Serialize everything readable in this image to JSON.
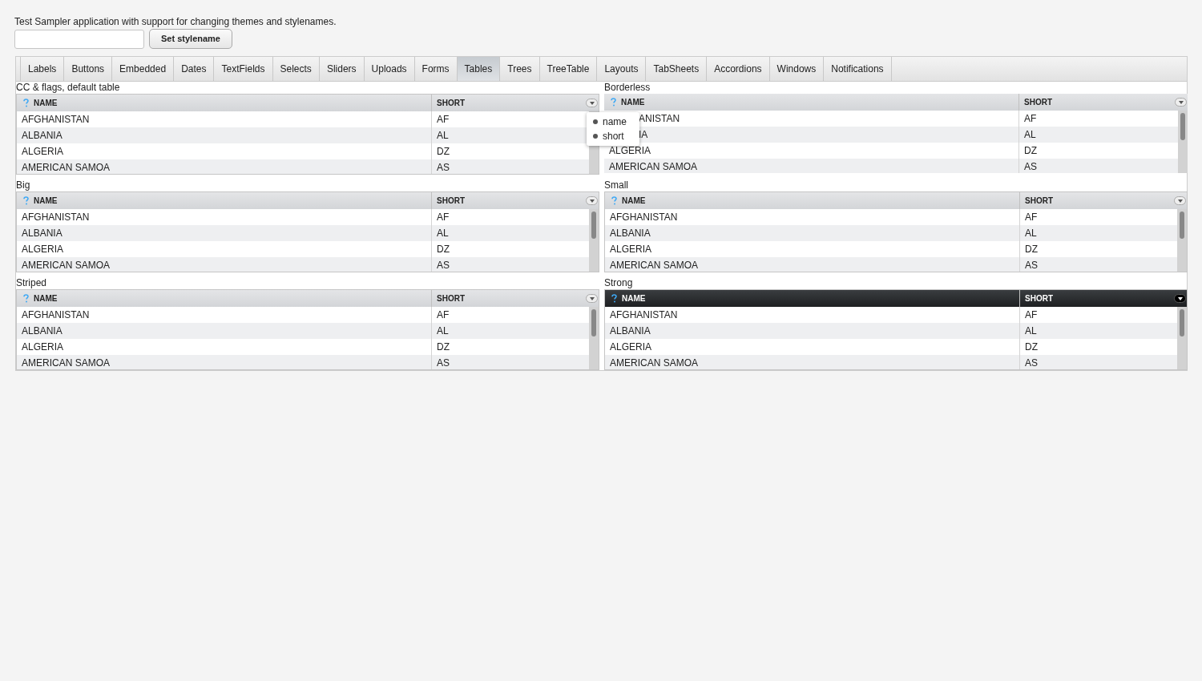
{
  "intro": "Test Sampler application with support for changing themes and stylenames.",
  "set_button": "Set stylename",
  "tabs": [
    {
      "label": "Labels",
      "selected": false
    },
    {
      "label": "Buttons",
      "selected": false
    },
    {
      "label": "Embedded",
      "selected": false
    },
    {
      "label": "Dates",
      "selected": false
    },
    {
      "label": "TextFields",
      "selected": false
    },
    {
      "label": "Selects",
      "selected": false
    },
    {
      "label": "Sliders",
      "selected": false
    },
    {
      "label": "Uploads",
      "selected": false
    },
    {
      "label": "Forms",
      "selected": false
    },
    {
      "label": "Tables",
      "selected": true
    },
    {
      "label": "Trees",
      "selected": false
    },
    {
      "label": "TreeTable",
      "selected": false
    },
    {
      "label": "Layouts",
      "selected": false
    },
    {
      "label": "TabSheets",
      "selected": false
    },
    {
      "label": "Accordions",
      "selected": false
    },
    {
      "label": "Windows",
      "selected": false
    },
    {
      "label": "Notifications",
      "selected": false
    }
  ],
  "tables": [
    {
      "caption": "CC & flags, default table",
      "kind": "default",
      "columns": [
        "NAME",
        "SHORT"
      ],
      "rows": [
        {
          "name": "AFGHANISTAN",
          "short": "AF"
        },
        {
          "name": "ALBANIA",
          "short": "AL"
        },
        {
          "name": "ALGERIA",
          "short": "DZ"
        },
        {
          "name": "AMERICAN SAMOA",
          "short": "AS"
        }
      ],
      "column_menu": {
        "items": [
          {
            "label": "name",
            "checked": true
          },
          {
            "label": "short",
            "checked": true
          }
        ]
      }
    },
    {
      "caption": "Borderless",
      "kind": "borderless",
      "columns": [
        "NAME",
        "SHORT"
      ],
      "rows": [
        {
          "name": "ANISTAN",
          "short": "AF",
          "partly_hidden": true
        },
        {
          "name": "IA",
          "short": "AL",
          "partly_hidden": true
        },
        {
          "name": "ALGERIA",
          "short": "DZ",
          "partly_hidden": false
        },
        {
          "name": "AMERICAN SAMOA",
          "short": "AS",
          "partly_hidden": false
        }
      ]
    },
    {
      "caption": "Big",
      "kind": "default",
      "columns": [
        "NAME",
        "SHORT"
      ],
      "rows": [
        {
          "name": "AFGHANISTAN",
          "short": "AF"
        },
        {
          "name": "ALBANIA",
          "short": "AL"
        },
        {
          "name": "ALGERIA",
          "short": "DZ"
        },
        {
          "name": "AMERICAN SAMOA",
          "short": "AS"
        }
      ]
    },
    {
      "caption": "Small",
      "kind": "default",
      "columns": [
        "NAME",
        "SHORT"
      ],
      "rows": [
        {
          "name": "AFGHANISTAN",
          "short": "AF"
        },
        {
          "name": "ALBANIA",
          "short": "AL"
        },
        {
          "name": "ALGERIA",
          "short": "DZ"
        },
        {
          "name": "AMERICAN SAMOA",
          "short": "AS"
        }
      ]
    },
    {
      "caption": "Striped",
      "kind": "default",
      "columns": [
        "NAME",
        "SHORT"
      ],
      "rows": [
        {
          "name": "AFGHANISTAN",
          "short": "AF"
        },
        {
          "name": "ALBANIA",
          "short": "AL"
        },
        {
          "name": "ALGERIA",
          "short": "DZ"
        },
        {
          "name": "AMERICAN SAMOA",
          "short": "AS"
        }
      ]
    },
    {
      "caption": "Strong",
      "kind": "strong",
      "columns": [
        "NAME",
        "SHORT"
      ],
      "rows": [
        {
          "name": "AFGHANISTAN",
          "short": "AF"
        },
        {
          "name": "ALBANIA",
          "short": "AL"
        },
        {
          "name": "ALGERIA",
          "short": "DZ"
        },
        {
          "name": "AMERICAN SAMOA",
          "short": "AS"
        }
      ]
    }
  ]
}
